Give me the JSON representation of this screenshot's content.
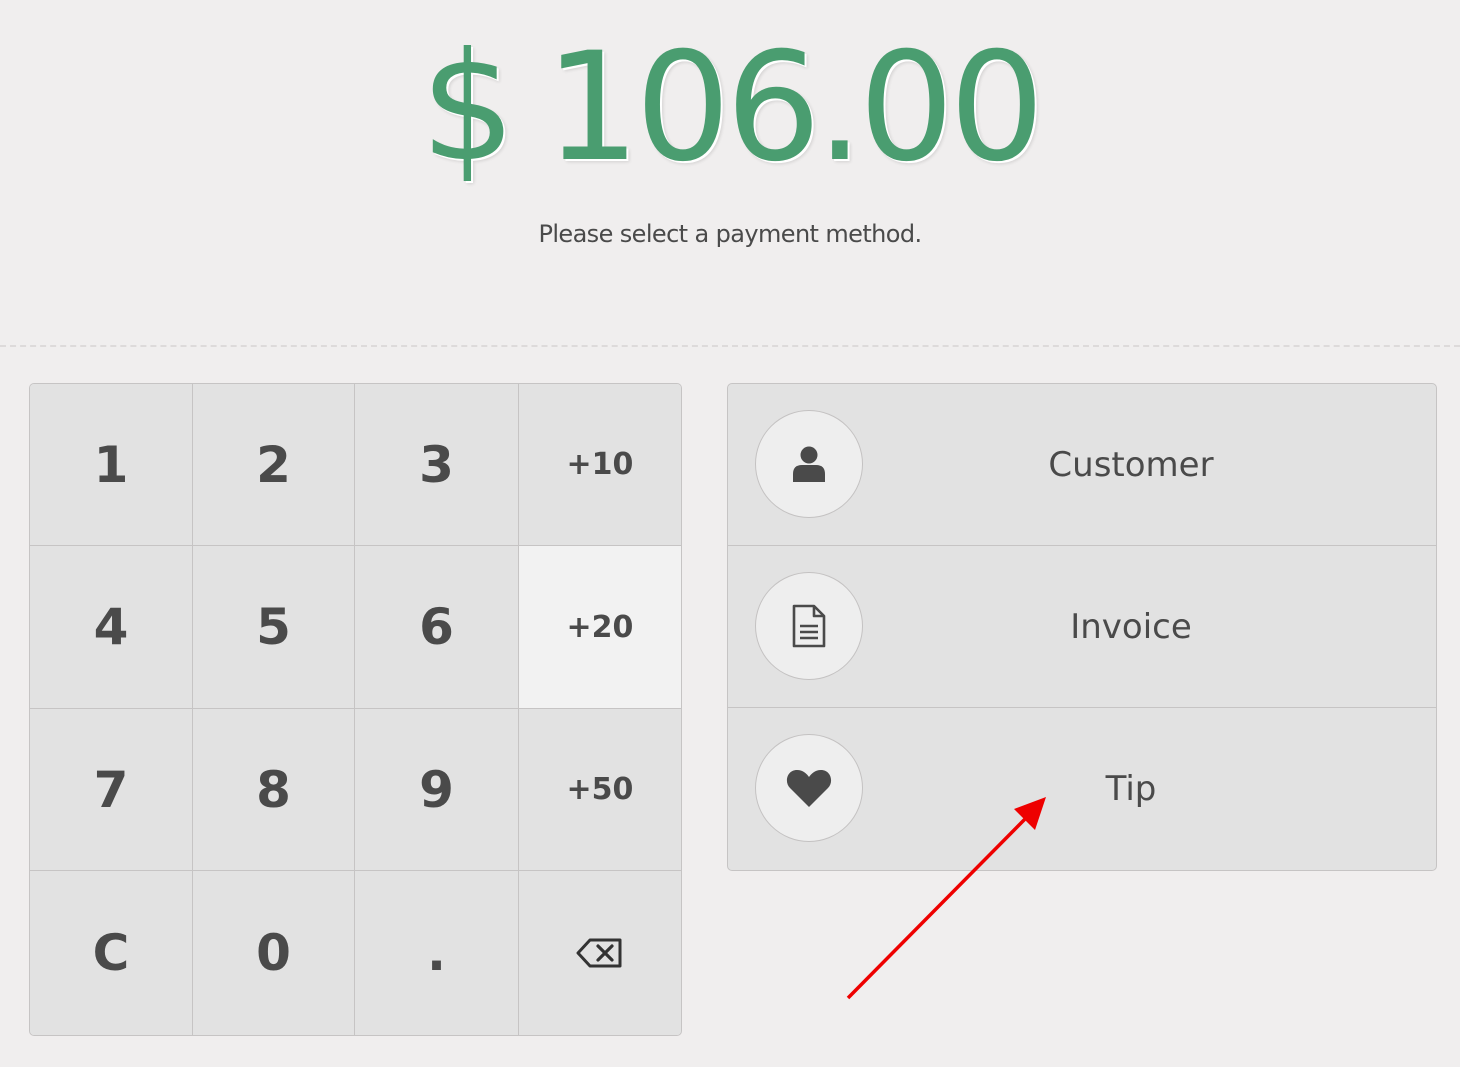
{
  "total": {
    "currency": "$",
    "amount": "106.00",
    "color": "#4a9d70"
  },
  "message": "Please select a payment method.",
  "numpad": {
    "keys": [
      {
        "label": "1"
      },
      {
        "label": "2"
      },
      {
        "label": "3"
      },
      {
        "label": "+10"
      },
      {
        "label": "4"
      },
      {
        "label": "5"
      },
      {
        "label": "6"
      },
      {
        "label": "+20",
        "active": true
      },
      {
        "label": "7"
      },
      {
        "label": "8"
      },
      {
        "label": "9"
      },
      {
        "label": "+50"
      },
      {
        "label": "C"
      },
      {
        "label": "0"
      },
      {
        "label": "."
      },
      {
        "icon": "backspace-icon"
      }
    ]
  },
  "payment_methods": [
    {
      "icon": "user-icon",
      "label": "Customer"
    },
    {
      "icon": "document-icon",
      "label": "Invoice"
    },
    {
      "icon": "heart-icon",
      "label": "Tip"
    }
  ],
  "annotation": {
    "type": "arrow",
    "color": "#ee0000",
    "target": "Tip"
  }
}
